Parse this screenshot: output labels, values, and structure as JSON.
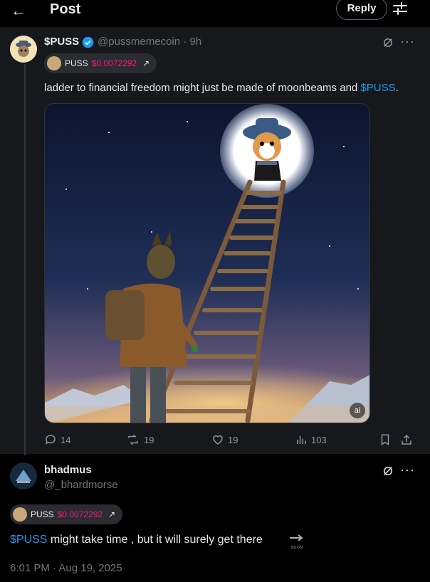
{
  "header": {
    "title": "Post",
    "reply_label": "Reply"
  },
  "post1": {
    "display_name": "$PUSS",
    "handle_time": "@pussmemecoin · 9h",
    "pill": {
      "ticker": "PUSS",
      "price": "$0.0072292",
      "arrow": "↗"
    },
    "text_before": "ladder to financial freedom might just be made of moonbeams and ",
    "cashtag": "$PUSS",
    "text_after": ".",
    "image_badge": "ai",
    "stats": {
      "replies": "14",
      "reposts": "19",
      "likes": "19",
      "views": "103"
    }
  },
  "post2": {
    "display_name": "bhadmus",
    "handle": "@_bhardmorse",
    "pill": {
      "ticker": "PUSS",
      "price": "$0.0072292",
      "arrow": "↗"
    },
    "cashtag": "$PUSS",
    "text": " might take time , but it will surely get there",
    "emoji_label": "SOON",
    "timestamp": "6:01 PM · Aug 19, 2025"
  },
  "colors": {
    "accent": "#1d9bf0",
    "price": "#f91880",
    "bg": "#000000"
  }
}
